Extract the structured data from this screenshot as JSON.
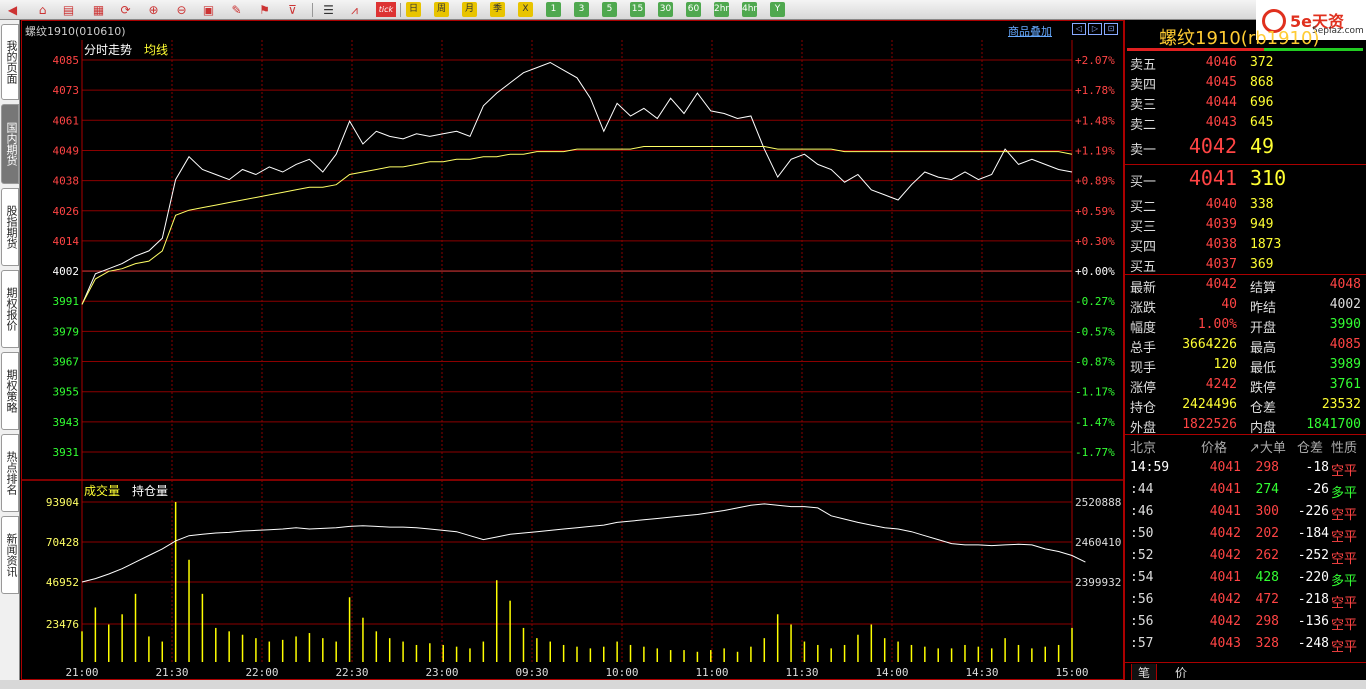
{
  "toolbar": {
    "periods": [
      "日",
      "周",
      "月",
      "季",
      "X",
      "1",
      "3",
      "5",
      "15",
      "30",
      "60",
      "2hr",
      "4hr",
      "Y"
    ],
    "tick_label": "tick"
  },
  "brand": {
    "logo_text": "5e天资",
    "sub_text": "5eplaz.com"
  },
  "side_tabs": [
    "我的页面",
    "国内期货",
    "股指期货",
    "期权报价",
    "期权策略",
    "热点排名",
    "新闻资讯"
  ],
  "chart": {
    "contract_title": "螺纹1910(010610)",
    "overlay_link": "商品叠加",
    "price_panel_title": "分时走势",
    "avg_label": "均线",
    "vol_panel_title": "成交量",
    "oi_label": "持仓量",
    "price_ticks": [
      "4085",
      "4073",
      "4061",
      "4049",
      "4038",
      "4026",
      "4014",
      "4002",
      "3991",
      "3979",
      "3967",
      "3955",
      "3943",
      "3931"
    ],
    "pct_ticks": [
      "+2.07%",
      "+1.78%",
      "+1.48%",
      "+1.19%",
      "+0.89%",
      "+0.59%",
      "+0.30%",
      "+0.00%",
      "-0.27%",
      "-0.57%",
      "-0.87%",
      "-1.17%",
      "-1.47%",
      "-1.77%"
    ],
    "vol_ticks": [
      "93904",
      "70428",
      "46952",
      "23476"
    ],
    "oi_ticks": [
      "2520888",
      "2460410",
      "2399932"
    ],
    "time_labels": [
      "21:00",
      "21:30",
      "22:00",
      "22:30",
      "23:00",
      "09:30",
      "10:00",
      "11:00",
      "11:30",
      "14:00",
      "14:30",
      "15:00"
    ],
    "colors": {
      "price_line": "#ffffff",
      "avg_line": "#ffff66",
      "grid": "#8b0000",
      "up": "#ff4444",
      "down": "#33ff33",
      "volume": "#ffff00"
    }
  },
  "chart_data": {
    "type": "line",
    "title": "分时走势",
    "series": [
      {
        "name": "价格",
        "values": [
          3989,
          4001,
          4003,
          4005,
          4008,
          4010,
          4015,
          4038,
          4047,
          4042,
          4040,
          4038,
          4042,
          4040,
          4043,
          4041,
          4044,
          4046,
          4041,
          4048,
          4061,
          4052,
          4057,
          4055,
          4054,
          4056,
          4055,
          4056,
          4057,
          4055,
          4067,
          4072,
          4076,
          4080,
          4082,
          4084,
          4081,
          4078,
          4070,
          4057,
          4068,
          4063,
          4066,
          4062,
          4070,
          4064,
          4072,
          4065,
          4064,
          4062,
          4063,
          4050,
          4039,
          4046,
          4048,
          4044,
          4042,
          4037,
          4040,
          4034,
          4032,
          4030,
          4036,
          4041,
          4039,
          4038,
          4041,
          4038,
          4040,
          4050,
          4044,
          4046,
          4044,
          4042,
          4041
        ]
      },
      {
        "name": "均线",
        "values": [
          3989,
          3999,
          4002,
          4003,
          4005,
          4006,
          4010,
          4024,
          4026,
          4027,
          4028,
          4029,
          4030,
          4031,
          4032,
          4033,
          4034,
          4035,
          4035,
          4036,
          4040,
          4041,
          4042,
          4043,
          4043,
          4044,
          4045,
          4045,
          4046,
          4046,
          4047,
          4047,
          4048,
          4048,
          4049,
          4049,
          4049,
          4050,
          4050,
          4050,
          4050,
          4050,
          4051,
          4051,
          4051,
          4051,
          4051,
          4051,
          4051,
          4051,
          4051,
          4051,
          4050,
          4050,
          4050,
          4050,
          4050,
          4049,
          4049,
          4049,
          4049,
          4049,
          4049,
          4049,
          4049,
          4049,
          4049,
          4049,
          4049,
          4049,
          4049,
          4049,
          4049,
          4049,
          4048
        ]
      }
    ],
    "volume_series": {
      "name": "成交量",
      "values": [
        18000,
        32000,
        22000,
        28000,
        40000,
        15000,
        12000,
        93904,
        60000,
        40000,
        20000,
        18000,
        16000,
        14000,
        12000,
        13000,
        15000,
        17000,
        14000,
        12000,
        38000,
        26000,
        18000,
        14000,
        12000,
        10000,
        11000,
        10000,
        9000,
        8000,
        12000,
        48000,
        36000,
        20000,
        14000,
        12000,
        10000,
        9000,
        8000,
        9000,
        12000,
        10000,
        9000,
        8000,
        7000,
        7000,
        6000,
        7000,
        8000,
        6000,
        9000,
        14000,
        28000,
        22000,
        12000,
        10000,
        8000,
        10000,
        16000,
        22000,
        14000,
        12000,
        10000,
        9000,
        8000,
        8000,
        10000,
        9000,
        8000,
        14000,
        10000,
        8000,
        9000,
        10000,
        20000
      ]
    },
    "oi_series": {
      "name": "持仓量",
      "values": [
        2399932,
        2405000,
        2412000,
        2420000,
        2430000,
        2440000,
        2450000,
        2462000,
        2470000,
        2472000,
        2474000,
        2475000,
        2477000,
        2478000,
        2479000,
        2480000,
        2482000,
        2480000,
        2481000,
        2482000,
        2484000,
        2485000,
        2484000,
        2483000,
        2483000,
        2482000,
        2480000,
        2478000,
        2476000,
        2470000,
        2464000,
        2468000,
        2472000,
        2474000,
        2476000,
        2478000,
        2480000,
        2482000,
        2484000,
        2486000,
        2490000,
        2492000,
        2494000,
        2496000,
        2498000,
        2500000,
        2502000,
        2505000,
        2508000,
        2512000,
        2516000,
        2518000,
        2516000,
        2514000,
        2514000,
        2512000,
        2500000,
        2495000,
        2490000,
        2486000,
        2482000,
        2480000,
        2476000,
        2470000,
        2464000,
        2458000,
        2456000,
        2456000,
        2455000,
        2456000,
        2457000,
        2456000,
        2450000,
        2446000,
        2440000,
        2430000
      ]
    },
    "ylim": [
      3931,
      4085
    ],
    "x_labels": [
      "21:00",
      "21:30",
      "22:00",
      "22:30",
      "23:00",
      "09:30",
      "10:00",
      "11:00",
      "11:30",
      "14:00",
      "14:30",
      "15:00"
    ]
  },
  "quote": {
    "name": "螺纹1910(rb1910)",
    "asks": [
      {
        "label": "卖五",
        "price": "4046",
        "vol": "372"
      },
      {
        "label": "卖四",
        "price": "4045",
        "vol": "868"
      },
      {
        "label": "卖三",
        "price": "4044",
        "vol": "696"
      },
      {
        "label": "卖二",
        "price": "4043",
        "vol": "645"
      },
      {
        "label": "卖一",
        "price": "4042",
        "vol": "49"
      }
    ],
    "bids": [
      {
        "label": "买一",
        "price": "4041",
        "vol": "310"
      },
      {
        "label": "买二",
        "price": "4040",
        "vol": "338"
      },
      {
        "label": "买三",
        "price": "4039",
        "vol": "949"
      },
      {
        "label": "买四",
        "price": "4038",
        "vol": "1873"
      },
      {
        "label": "买五",
        "price": "4037",
        "vol": "369"
      }
    ],
    "stats": [
      {
        "l1": "最新",
        "v1": "4042",
        "c1": "#ff4444",
        "l2": "结算",
        "v2": "4048",
        "c2": "#ff4444"
      },
      {
        "l1": "涨跌",
        "v1": "40",
        "c1": "#ff4444",
        "l2": "昨结",
        "v2": "4002",
        "c2": "#dddddd"
      },
      {
        "l1": "幅度",
        "v1": "1.00%",
        "c1": "#ff4444",
        "l2": "开盘",
        "v2": "3990",
        "c2": "#33ff33"
      },
      {
        "l1": "总手",
        "v1": "3664226",
        "c1": "#ffff33",
        "l2": "最高",
        "v2": "4085",
        "c2": "#ff4444"
      },
      {
        "l1": "现手",
        "v1": "120",
        "c1": "#ffff33",
        "l2": "最低",
        "v2": "3989",
        "c2": "#33ff33"
      },
      {
        "l1": "涨停",
        "v1": "4242",
        "c1": "#ff4444",
        "l2": "跌停",
        "v2": "3761",
        "c2": "#33ff33"
      },
      {
        "l1": "持仓",
        "v1": "2424496",
        "c1": "#ffff33",
        "l2": "仓差",
        "v2": "23532",
        "c2": "#ffff33"
      },
      {
        "l1": "外盘",
        "v1": "1822526",
        "c1": "#ff4444",
        "l2": "内盘",
        "v2": "1841700",
        "c2": "#33ff33"
      }
    ],
    "ticks_header": {
      "city": "北京",
      "price": "价格",
      "vol": "↗大单",
      "oi": "仓差",
      "nature": "性质"
    },
    "ticks": [
      {
        "time": "14:59",
        "price": "4041",
        "vol": "298",
        "oi": "-18",
        "nature": "空平",
        "pc": "#ff4444",
        "nc": "#ff4444"
      },
      {
        "time": ":44",
        "price": "4041",
        "vol": "274",
        "oi": "-26",
        "nature": "多平",
        "pc": "#ff4444",
        "nc": "#33ff33"
      },
      {
        "time": ":46",
        "price": "4041",
        "vol": "300",
        "oi": "-226",
        "nature": "空平",
        "pc": "#ff4444",
        "nc": "#ff4444"
      },
      {
        "time": ":50",
        "price": "4042",
        "vol": "202",
        "oi": "-184",
        "nature": "空平",
        "pc": "#ff4444",
        "nc": "#ff4444"
      },
      {
        "time": ":52",
        "price": "4042",
        "vol": "262",
        "oi": "-252",
        "nature": "空平",
        "pc": "#ff4444",
        "nc": "#ff4444"
      },
      {
        "time": ":54",
        "price": "4041",
        "vol": "428",
        "oi": "-220",
        "nature": "多平",
        "pc": "#ff4444",
        "nc": "#33ff33"
      },
      {
        "time": ":56",
        "price": "4042",
        "vol": "472",
        "oi": "-218",
        "nature": "空平",
        "pc": "#ff4444",
        "nc": "#ff4444"
      },
      {
        "time": ":56",
        "price": "4042",
        "vol": "298",
        "oi": "-136",
        "nature": "空平",
        "pc": "#ff4444",
        "nc": "#ff4444"
      },
      {
        "time": ":57",
        "price": "4043",
        "vol": "328",
        "oi": "-248",
        "nature": "空平",
        "pc": "#ff4444",
        "nc": "#ff4444"
      }
    ],
    "bottom_tabs": [
      "笔",
      "价"
    ]
  }
}
